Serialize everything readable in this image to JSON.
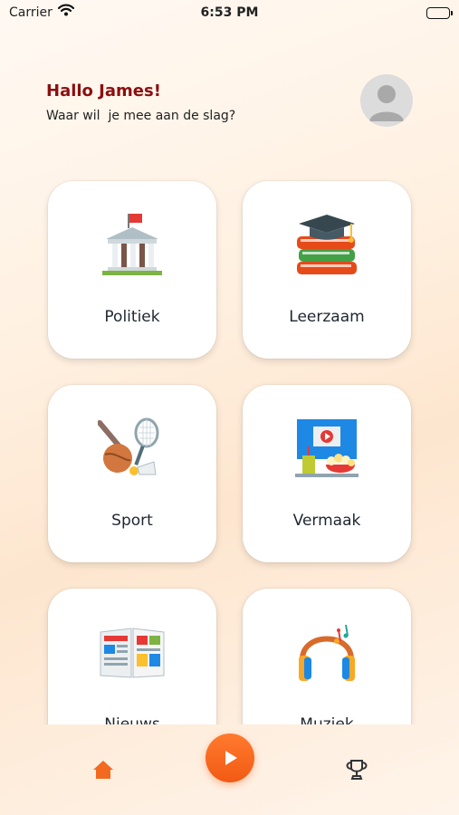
{
  "status_bar": {
    "carrier": "Carrier",
    "time": "6:53 PM"
  },
  "header": {
    "greeting": "Hallo James!",
    "subtitle": "Waar wil  je mee aan de slag?"
  },
  "categories": [
    {
      "label": "Politiek",
      "icon": "government-building-icon"
    },
    {
      "label": "Leerzaam",
      "icon": "books-graduation-cap-icon"
    },
    {
      "label": "Sport",
      "icon": "sports-equipment-icon"
    },
    {
      "label": "Vermaak",
      "icon": "movie-popcorn-icon"
    },
    {
      "label": "Nieuws",
      "icon": "newspaper-icon"
    },
    {
      "label": "Muziek",
      "icon": "headphones-icon"
    }
  ],
  "tabbar": {
    "active_tab": "home",
    "icons": [
      "home-icon",
      "play-icon",
      "trophy-icon"
    ]
  },
  "colors": {
    "greeting": "#8b0f10",
    "accent": "#f25a14",
    "card_background": "#ffffff"
  }
}
